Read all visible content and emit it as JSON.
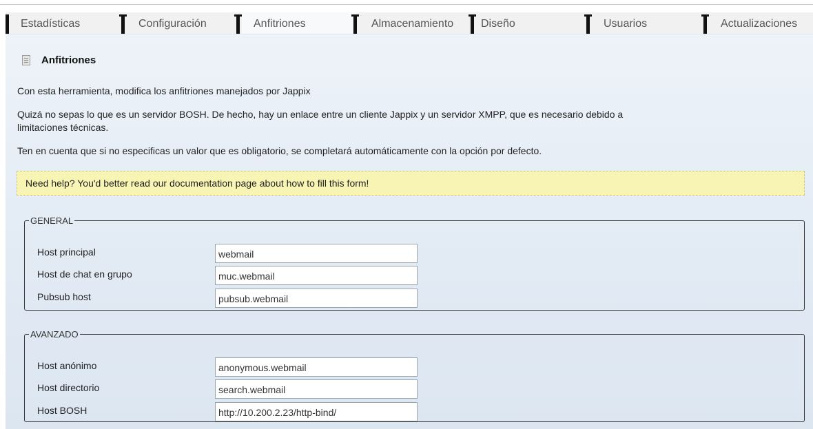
{
  "tabs": [
    {
      "label": "Estadísticas",
      "active": false
    },
    {
      "label": "Configuración",
      "active": false
    },
    {
      "label": "Anfitriones",
      "active": true
    },
    {
      "label": "Almacenamiento",
      "active": false
    },
    {
      "label": "Diseño",
      "active": false
    },
    {
      "label": "Usuarios",
      "active": false
    },
    {
      "label": "Actualizaciones",
      "active": false
    }
  ],
  "section": {
    "icon": "document-icon",
    "title": "Anfitriones"
  },
  "paragraphs": {
    "intro": "Con esta herramienta, modifica los anfitriones manejados por Jappix",
    "bosh_info_line1": "Quizá no sepas lo que es un servidor BOSH. De hecho, hay un enlace entre un cliente Jappix y un servidor XMPP, que es necesario debido a",
    "bosh_info_line2": "limitaciones técnicas.",
    "defaults_note": "Ten en cuenta que si no especificas un valor que es obligatorio, se completará automáticamente con la opción por defecto."
  },
  "help": {
    "text": "Need help? You'd better read our documentation page about how to fill this form!"
  },
  "general": {
    "legend": "GENERAL",
    "fields": [
      {
        "label": "Host principal",
        "value": "webmail"
      },
      {
        "label": "Host de chat en grupo",
        "value": "muc.webmail"
      },
      {
        "label": "Pubsub host",
        "value": "pubsub.webmail"
      }
    ]
  },
  "advanced": {
    "legend": "AVANZADO",
    "fields": [
      {
        "label": "Host anónimo",
        "value": "anonymous.webmail"
      },
      {
        "label": "Host directorio",
        "value": "search.webmail"
      },
      {
        "label": "Host BOSH",
        "value": "http://10.200.2.23/http-bind/"
      }
    ]
  },
  "colors": {
    "panel_top": "#eef3f9",
    "panel_bottom": "#dce6f1",
    "help_background": "#f8f5b4",
    "tab_separator": "#111111"
  }
}
